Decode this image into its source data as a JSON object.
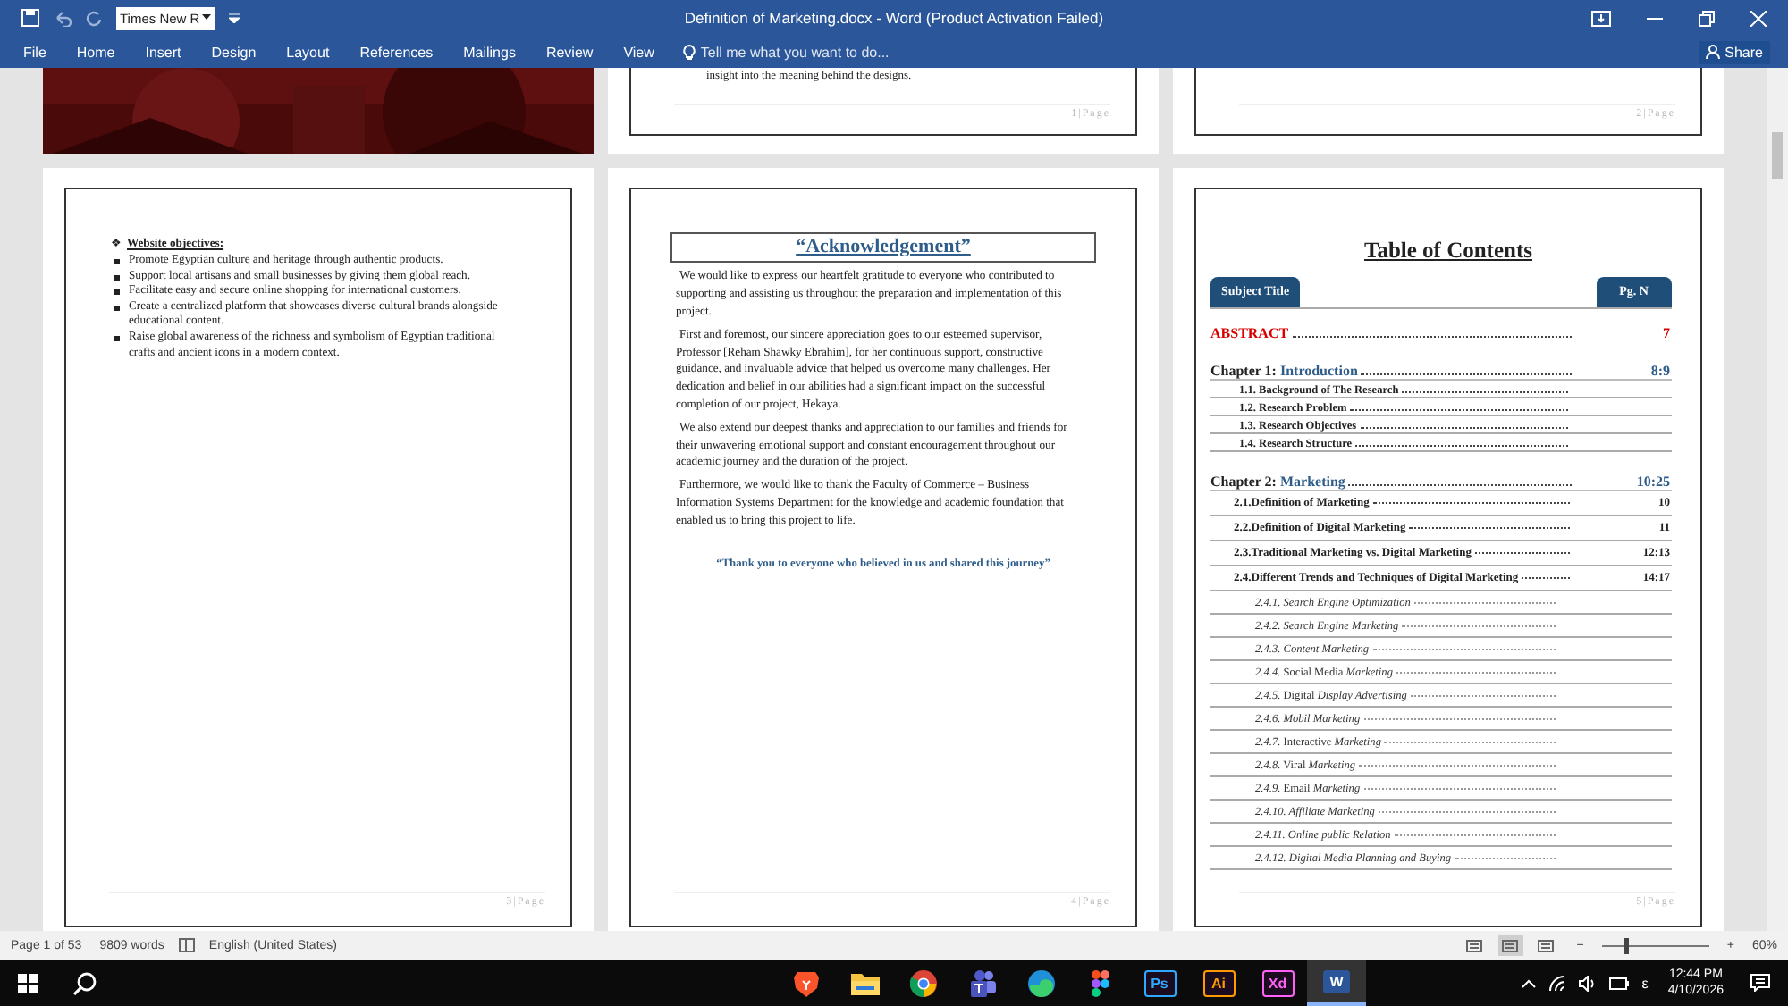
{
  "title_bar": {
    "font_box": "Times New R",
    "title": "Definition of Marketing.docx - Word (Product Activation Failed)"
  },
  "ribbon": {
    "tabs": [
      {
        "label": "File",
        "selected": false
      },
      {
        "label": "Home",
        "selected": false
      },
      {
        "label": "Insert",
        "selected": false
      },
      {
        "label": "Design",
        "selected": false
      },
      {
        "label": "Layout",
        "selected": false
      },
      {
        "label": "References",
        "selected": false
      },
      {
        "label": "Mailings",
        "selected": false
      },
      {
        "label": "Review",
        "selected": false
      },
      {
        "label": "View",
        "selected": false
      }
    ],
    "tell_me": "Tell me what you want to do...",
    "share": "Share"
  },
  "top_pages": [
    {
      "kind": "picture"
    },
    {
      "kind": "text",
      "text": "insight into the meaning behind the designs.",
      "footer": "1|Page"
    },
    {
      "kind": "blank",
      "footer": "2|Page"
    }
  ],
  "pages": [
    {
      "kind": "objectives",
      "heading_marker": "❖",
      "heading": "Website objectives:",
      "items": [
        "Promote Egyptian culture and heritage through authentic products.",
        "Support local artisans and small businesses by giving them global reach.",
        "Facilitate easy and secure online shopping for international customers.",
        "Create a centralized platform that showcases diverse cultural brands alongside educational content.",
        "Raise global awareness of the richness and symbolism of Egyptian traditional crafts and ancient icons in a modern context."
      ],
      "footer": "3|Page"
    },
    {
      "kind": "acknowledgement",
      "title": "“Acknowledgement”",
      "paragraphs": [
        "We would like to express our heartfelt gratitude to everyone who contributed to supporting and assisting us throughout the preparation and implementation of this project.",
        "First and foremost, our sincere appreciation goes to our esteemed supervisor, Professor [Reham Shawky Ebrahim], for her continuous support, constructive guidance, and invaluable advice that helped us overcome many challenges. Her dedication and belief in our abilities had a significant impact on the successful completion of our project, Hekaya.",
        "We also extend our deepest thanks and appreciation to our families and friends for their unwavering emotional support and constant encouragement throughout our academic journey and the duration of the project.",
        "Furthermore, we would like to thank the Faculty of Commerce – Business Information Systems Department for the knowledge and academic foundation that enabled us to bring this project to life."
      ],
      "closing": "“Thank you to everyone who believed in us and shared this journey”",
      "footer": "4|Page"
    },
    {
      "kind": "toc",
      "title": "Table of Contents",
      "header_left": "Subject Title",
      "header_right": "Pg. N",
      "entries": [
        {
          "kind": "abstract",
          "title": "ABSTRACT",
          "page": "7"
        },
        {
          "kind": "chapter",
          "label": "Chapter 1:",
          "title": "Introduction",
          "page": "8:9"
        },
        {
          "kind": "topic",
          "title": "1.1. Background of The Research"
        },
        {
          "kind": "topic",
          "title": "1.2. Research Problem"
        },
        {
          "kind": "topic",
          "title": "1.3. Research Objectives"
        },
        {
          "kind": "topic",
          "title": "1.4. Research Structure"
        },
        {
          "kind": "chapter",
          "label": "Chapter 2:",
          "title": "Marketing",
          "page": "10:25"
        },
        {
          "kind": "section",
          "title": "2.1.Definition of Marketing",
          "page": "10"
        },
        {
          "kind": "section",
          "title": "2.2.Definition of Digital Marketing",
          "page": "11"
        },
        {
          "kind": "section",
          "title": "2.3.Traditional Marketing vs. Digital Marketing",
          "page": "12:13"
        },
        {
          "kind": "section",
          "title": "2.4.Different Trends and Techniques of Digital Marketing",
          "page": "14:17"
        },
        {
          "kind": "subsection",
          "title": "2.4.1. Search Engine Optimization"
        },
        {
          "kind": "subsection",
          "title": "2.4.2. Search Engine Marketing"
        },
        {
          "kind": "subsection",
          "title": "2.4.3. Content Marketing"
        },
        {
          "kind": "subsection-mixed",
          "title": "*2.4.4.* Social Media *Marketing*"
        },
        {
          "kind": "subsection-mixed",
          "title": "*2.4.5.* Digital *Display Advertising*"
        },
        {
          "kind": "subsection",
          "title": "2.4.6. Mobil Marketing"
        },
        {
          "kind": "subsection-mixed",
          "title": "*2.4.7.* Interactive *Marketing*"
        },
        {
          "kind": "subsection-mixed",
          "title": "*2.4.8.* Viral *Marketing*"
        },
        {
          "kind": "subsection-mixed",
          "title": "*2.4.9.* Email *Marketing*"
        },
        {
          "kind": "subsection",
          "title": "2.4.10. Affiliate Marketing"
        },
        {
          "kind": "subsection",
          "title": "2.4.11. Online public Relation"
        },
        {
          "kind": "subsection",
          "title": "2.4.12. Digital Media Planning and Buying"
        }
      ],
      "footer": "5|Page"
    }
  ],
  "status_bar": {
    "page": "Page 1 of 53",
    "words": "9809 words",
    "language": "English (United States)",
    "views": [
      {
        "selected": false
      },
      {
        "selected": true
      },
      {
        "selected": false
      }
    ],
    "zoom_out": "−",
    "zoom_in": "+",
    "zoom": {
      "level": 0.22,
      "reading": "60%"
    }
  },
  "taskbar": {
    "apps": [
      {
        "kind": "brave",
        "selected": false
      },
      {
        "kind": "folder",
        "selected": false
      },
      {
        "kind": "chrome",
        "selected": false
      },
      {
        "kind": "teams",
        "selected": false
      },
      {
        "kind": "edge",
        "selected": false
      },
      {
        "kind": "figma",
        "selected": false
      },
      {
        "kind": "badge",
        "label": "Ps",
        "color": "#31a8ff",
        "selected": false
      },
      {
        "kind": "badge",
        "label": "Ai",
        "color": "#ff9a00",
        "selected": false
      },
      {
        "kind": "badge",
        "label": "Xd",
        "color": "#ff61f6",
        "selected": false
      },
      {
        "kind": "word",
        "label": "W",
        "selected": true
      }
    ],
    "input": "ε",
    "time": "12:44 PM",
    "date": "4/10/2026"
  }
}
